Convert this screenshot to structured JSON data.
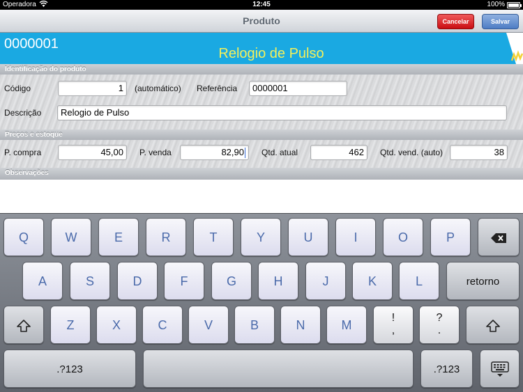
{
  "status_bar": {
    "carrier": "Operadora",
    "time": "12:45",
    "battery": "100%"
  },
  "nav": {
    "title": "Produto",
    "cancel_label": "Cancelar",
    "save_label": "Salvar"
  },
  "header": {
    "code": "0000001",
    "name": "Relogio de Pulso"
  },
  "section_identification": {
    "title": "Identificação do produto",
    "codigo_label": "Código",
    "codigo_value": "1",
    "automatic_note": "(automático)",
    "referencia_label": "Referência",
    "referencia_value": "0000001",
    "descricao_label": "Descrição",
    "descricao_value": "Relogio de Pulso"
  },
  "section_prices": {
    "title": "Preços e estoque",
    "p_compra_label": "P. compra",
    "p_compra_value": "45,00",
    "p_venda_label": "P. venda",
    "p_venda_value": "82,90",
    "qtd_atual_label": "Qtd. atual",
    "qtd_atual_value": "462",
    "qtd_vend_label": "Qtd. vend. (auto)",
    "qtd_vend_value": "38"
  },
  "section_obs": {
    "title": "Observações"
  },
  "keyboard": {
    "row1": [
      "Q",
      "W",
      "E",
      "R",
      "T",
      "Y",
      "U",
      "I",
      "O",
      "P"
    ],
    "row2": [
      "A",
      "S",
      "D",
      "F",
      "G",
      "H",
      "J",
      "K",
      "L"
    ],
    "return_label": "retorno",
    "row3": [
      "Z",
      "X",
      "C",
      "V",
      "B",
      "N",
      "M"
    ],
    "punct1_top": "!",
    "punct1_bottom": ",",
    "punct2_top": "?",
    "punct2_bottom": ".",
    "numbers_label": ".?123"
  },
  "colors": {
    "banner": "#1aa9e2",
    "banner_name": "#f4f05a",
    "cancel": "#c90d12",
    "save": "#4d7cc4",
    "key_text": "#3b5a9c"
  },
  "icons": {
    "wifi": "wifi-icon",
    "battery": "battery-icon",
    "backspace": "backspace-icon",
    "shift": "shift-icon",
    "hide_keyboard": "keyboard-hide-icon"
  }
}
